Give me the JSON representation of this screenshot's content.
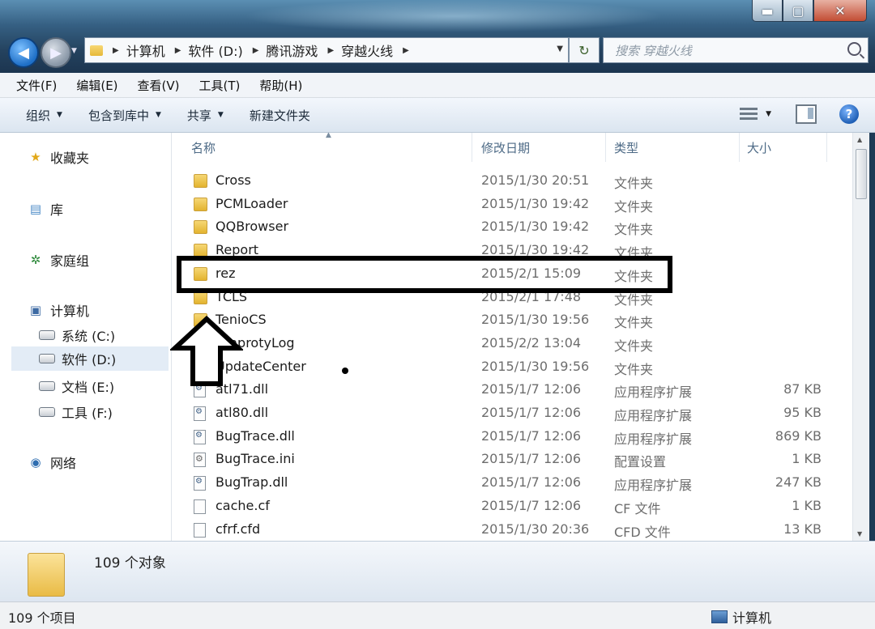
{
  "title_bar": {
    "minimize": "▬",
    "maximize": "▢",
    "close": "✕"
  },
  "nav": {
    "back": "◀",
    "forward": "▶"
  },
  "address": {
    "crumbs": [
      "计算机",
      "软件 (D:)",
      "腾讯游戏",
      "穿越火线"
    ]
  },
  "search": {
    "placeholder": "搜索 穿越火线"
  },
  "menu": [
    "文件(F)",
    "编辑(E)",
    "查看(V)",
    "工具(T)",
    "帮助(H)"
  ],
  "toolbar": {
    "organize": "组织",
    "include_library": "包含到库中",
    "share": "共享",
    "new_folder": "新建文件夹",
    "help": "?"
  },
  "sidebar": [
    {
      "label": "收藏夹",
      "icon": "star-icon"
    },
    {
      "label": "库",
      "icon": "library-icon"
    },
    {
      "label": "家庭组",
      "icon": "homegroup-icon"
    },
    {
      "label": "计算机",
      "icon": "computer-icon"
    },
    {
      "label": "系统 (C:)",
      "icon": "drive-icon"
    },
    {
      "label": "软件 (D:)",
      "icon": "drive-icon",
      "selected": true
    },
    {
      "label": "文档 (E:)",
      "icon": "drive-icon"
    },
    {
      "label": "工具 (F:)",
      "icon": "drive-icon"
    },
    {
      "label": "网络",
      "icon": "network-icon"
    }
  ],
  "columns": [
    "名称",
    "修改日期",
    "类型",
    "大小"
  ],
  "files": [
    {
      "name": "Cross",
      "date": "2015/1/30 20:51",
      "type": "文件夹",
      "size": "",
      "icon": "folder-icon"
    },
    {
      "name": "PCMLoader",
      "date": "2015/1/30 19:42",
      "type": "文件夹",
      "size": "",
      "icon": "folder-icon"
    },
    {
      "name": "QQBrowser",
      "date": "2015/1/30 19:42",
      "type": "文件夹",
      "size": "",
      "icon": "folder-icon"
    },
    {
      "name": "Report",
      "date": "2015/1/30 19:42",
      "type": "文件夹",
      "size": "",
      "icon": "folder-icon"
    },
    {
      "name": "rez",
      "date": "2015/2/1 15:09",
      "type": "文件夹",
      "size": "",
      "icon": "folder-icon"
    },
    {
      "name": "TCLS",
      "date": "2015/2/1 17:48",
      "type": "文件夹",
      "size": "",
      "icon": "folder-icon"
    },
    {
      "name": "TenioCS",
      "date": "2015/1/30 19:56",
      "type": "文件夹",
      "size": "",
      "icon": "folder-icon"
    },
    {
      "name": "TenprotyLog",
      "date": "2015/2/2 13:04",
      "type": "文件夹",
      "size": "",
      "icon": "folder-icon"
    },
    {
      "name": "UpdateCenter",
      "date": "2015/1/30 19:56",
      "type": "文件夹",
      "size": "",
      "icon": "folder-icon"
    },
    {
      "name": "atl71.dll",
      "date": "2015/1/7 12:06",
      "type": "应用程序扩展",
      "size": "87 KB",
      "icon": "dll-icon"
    },
    {
      "name": "atl80.dll",
      "date": "2015/1/7 12:06",
      "type": "应用程序扩展",
      "size": "95 KB",
      "icon": "dll-icon"
    },
    {
      "name": "BugTrace.dll",
      "date": "2015/1/7 12:06",
      "type": "应用程序扩展",
      "size": "869 KB",
      "icon": "dll-icon"
    },
    {
      "name": "BugTrace.ini",
      "date": "2015/1/7 12:06",
      "type": "配置设置",
      "size": "1 KB",
      "icon": "ini-icon"
    },
    {
      "name": "BugTrap.dll",
      "date": "2015/1/7 12:06",
      "type": "应用程序扩展",
      "size": "247 KB",
      "icon": "dll-icon"
    },
    {
      "name": "cache.cf",
      "date": "2015/1/7 12:06",
      "type": "CF 文件",
      "size": "1 KB",
      "icon": "file-icon"
    },
    {
      "name": "cfrf.cfd",
      "date": "2015/1/30 20:36",
      "type": "CFD 文件",
      "size": "13 KB",
      "icon": "file-icon"
    }
  ],
  "details": {
    "count": "109 个对象"
  },
  "status": {
    "items": "109 个项目",
    "location": "计算机"
  }
}
